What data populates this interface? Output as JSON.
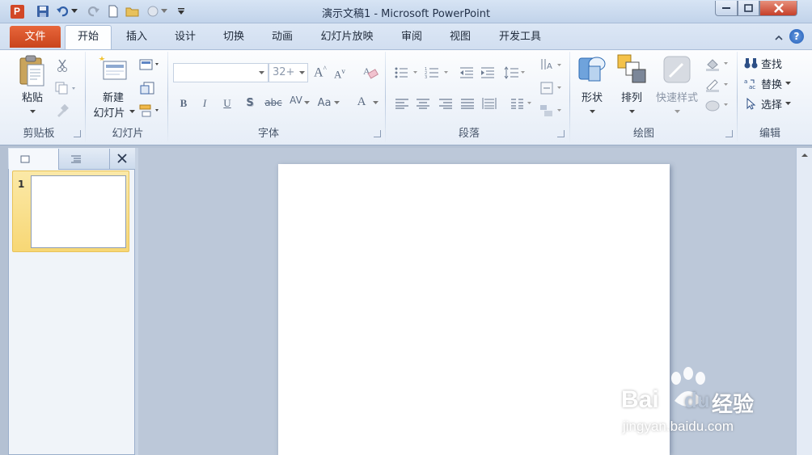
{
  "window": {
    "title": "演示文稿1 - Microsoft PowerPoint",
    "quick_access": [
      "powerpoint-app-icon",
      "save-icon",
      "undo-icon",
      "dropdown-icon",
      "redo-icon",
      "new-document-icon",
      "open-folder-icon",
      "customize-icon",
      "customize-qa-dropdown-icon"
    ]
  },
  "tabs": {
    "file": "文件",
    "home": "开始",
    "insert": "插入",
    "design": "设计",
    "transitions": "切换",
    "animations": "动画",
    "slideshow": "幻灯片放映",
    "review": "审阅",
    "view": "视图",
    "developer": "开发工具"
  },
  "ribbon": {
    "clipboard": {
      "label": "剪贴板",
      "paste": "粘贴"
    },
    "slides": {
      "label": "幻灯片",
      "new_slide_line1": "新建",
      "new_slide_line2": "幻灯片"
    },
    "font": {
      "label": "字体",
      "font_name": "",
      "font_size": "32+",
      "bold": "B",
      "italic": "I",
      "underline": "U",
      "shadow": "S",
      "strike": "abc",
      "spacing": "AV",
      "case": "Aa",
      "color": "A",
      "grow": "A",
      "shrink": "A"
    },
    "paragraph": {
      "label": "段落"
    },
    "drawing": {
      "label": "绘图",
      "shapes": "形状",
      "arrange": "排列",
      "quick_styles": "快速样式"
    },
    "editing": {
      "label": "编辑",
      "find": "查找",
      "replace": "替换",
      "select": "选择"
    }
  },
  "left_pane": {
    "slide_number": "1"
  },
  "watermark": {
    "brand": "Bai",
    "brand2": "du",
    "product": "经验",
    "url": "jingyan.baidu.com"
  },
  "colors": {
    "file_tab": "#d4512a",
    "ribbon_bg": "#f3f6fb",
    "workspace": "#bcc8d9"
  }
}
